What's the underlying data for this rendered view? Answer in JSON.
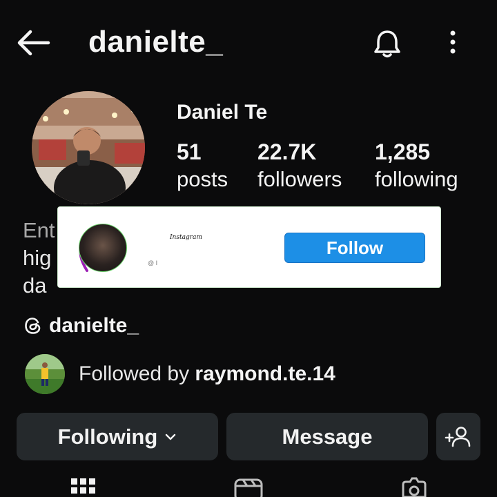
{
  "header": {
    "username": "danielte_",
    "back_icon": "arrow-left-icon",
    "bell_icon": "bell-icon",
    "more_icon": "more-vertical-icon"
  },
  "profile": {
    "display_name": "Daniel Te",
    "stats": [
      {
        "value": "51",
        "label": "posts"
      },
      {
        "value": "22.7K",
        "label": "followers"
      },
      {
        "value": "1,285",
        "label": "following"
      }
    ],
    "bio_lines": [
      "Ent",
      "hig",
      "da"
    ]
  },
  "popup": {
    "app_name": "Instagram",
    "handle_partial": "@ I",
    "follow_label": "Follow",
    "accent": "#1d8fe6"
  },
  "threads": {
    "icon": "threads-icon",
    "handle": "danielte_"
  },
  "followed_by": {
    "prefix": "Followed by ",
    "user": "raymond.te.14"
  },
  "actions": {
    "following_label": "Following",
    "message_label": "Message",
    "add_user_icon": "add-user-icon"
  },
  "tabs": [
    "grid-icon",
    "reels-icon",
    "tagged-icon"
  ]
}
